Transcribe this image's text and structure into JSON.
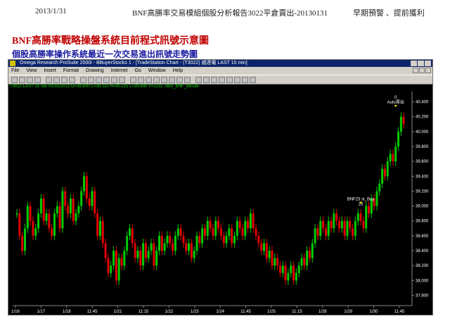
{
  "header": {
    "date": "2013/1/31",
    "title": "BNF高勝率交易模組個股分析報告3022平倉賣出-20130131",
    "right": "早期預警 、提前獲利"
  },
  "headings": {
    "main": "BNF高勝率戰略操盤系統目前程式訊號示意圖",
    "sub": "個股高勝率操作系統最近一次交易進出訊號走勢圖"
  },
  "window": {
    "title": "Omega Research ProSuite 2000i - BBuyerStocks 1 - [TradeStation Chart - (T3022) 威達電 LAST 15 min]",
    "menu": [
      "File",
      "View",
      "Insert",
      "Format",
      "Drawing",
      "Internet",
      "Go",
      "Window",
      "Help"
    ],
    "toolbar_icons": [
      "new-icon",
      "open-icon",
      "save-icon",
      "print-icon",
      "cut-icon",
      "copy-icon",
      "paste-icon",
      "chart-icon",
      "back-icon",
      "forward-icon",
      "zoom-in-icon",
      "zoom-out-icon",
      "cursor-icon",
      "pen-icon",
      "line-icon",
      "grid-icon",
      "table-icon",
      "bar-icon",
      "bar2-icon",
      "bar3-icon",
      "list-icon",
      "plus-icon",
      "bars-icon",
      "bars2-icon",
      "crosshair-icon",
      "zoom-icon",
      "magnify-icon",
      "tool-icon",
      "select-icon",
      "help-icon"
    ]
  },
  "info_line": "T3022 LAST-15 min   01/31/2013   O=39.800   C=39.110   H=40.215   L=39.600   V=1211   .0BS_BNF_Minute",
  "colors": {
    "up": "#00cc00",
    "down": "#e00000",
    "bg": "#000000",
    "axis_text": "#ffffff",
    "signal": "#ffffff"
  },
  "chart_data": {
    "type": "candlestick",
    "y_ticks": [
      "40.400",
      "40.200",
      "40.000",
      "39.800",
      "39.600",
      "39.400",
      "39.200",
      "39.000",
      "38.800",
      "38.600",
      "38.400",
      "38.200",
      "38.000",
      "37.800"
    ],
    "ylim": [
      37.7,
      40.5
    ],
    "x_ticks": [
      "1/16",
      "1/17",
      "1/18",
      "11:45",
      "1/21",
      "11:15",
      "1/22",
      "1/23",
      "1/24",
      "11:45",
      "1/25",
      "11:15",
      "1/28",
      "1/29",
      "1/30",
      "11:45"
    ],
    "signals": [
      {
        "label": "BNF23 st_Buy",
        "sub": "23",
        "near": 39.0
      },
      {
        "label": "Auto賣出",
        "sub": "0",
        "near": 40.3
      }
    ],
    "series": [
      {
        "values": [
          38.9,
          38.6,
          38.4,
          38.7,
          39.0,
          38.8,
          38.6,
          38.7,
          38.9,
          39.1,
          38.8,
          38.9,
          38.7,
          38.6,
          38.9,
          39.0,
          38.7,
          39.2,
          39.0,
          38.9,
          39.1,
          38.8,
          38.9,
          39.0,
          39.2,
          39.4,
          39.1,
          39.0,
          39.2,
          38.9,
          38.6,
          38.8,
          38.5,
          38.3,
          38.1,
          38.2,
          38.4,
          38.0,
          38.3,
          38.2,
          38.4,
          38.6,
          38.7,
          38.5,
          38.3,
          38.4,
          38.2,
          38.5,
          38.3,
          38.4,
          38.5,
          38.2,
          38.4,
          38.6,
          38.4,
          38.5,
          38.6,
          38.5,
          38.4,
          38.6,
          38.7,
          38.6,
          38.5,
          38.4,
          38.5,
          38.3,
          38.4,
          38.6,
          38.5,
          38.7,
          38.6,
          38.8,
          38.7,
          38.6,
          38.8,
          38.7,
          38.6,
          38.5,
          38.6,
          38.7,
          38.5,
          38.6,
          38.8,
          38.7,
          38.6,
          38.8,
          38.7,
          38.9,
          38.7,
          38.6,
          38.5,
          38.4,
          38.5,
          38.3,
          38.4,
          38.2,
          38.3,
          38.2,
          38.1,
          38.2,
          38.0,
          38.1,
          38.2,
          38.0,
          38.1,
          38.2,
          38.3,
          38.2,
          38.4,
          38.3,
          38.5,
          38.7,
          38.6,
          38.8,
          38.7,
          38.6,
          38.8,
          38.7,
          38.9,
          38.8,
          38.7,
          38.8,
          38.6,
          38.8,
          38.7,
          38.6,
          38.8,
          38.9,
          38.8,
          38.7,
          39.0,
          38.9,
          39.1,
          39.0,
          39.2,
          39.3,
          39.5,
          39.4,
          39.6,
          39.7,
          39.6,
          39.8,
          40.0,
          40.2,
          40.1
        ]
      }
    ]
  }
}
